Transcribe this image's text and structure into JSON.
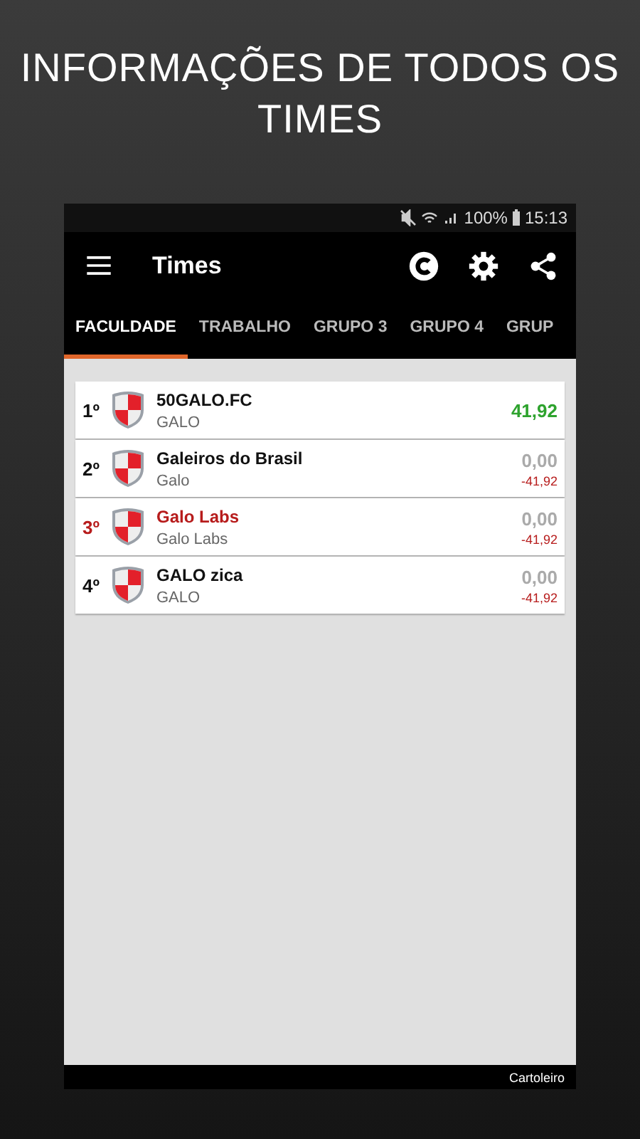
{
  "headline": "INFORMAÇÕES DE TODOS OS TIMES",
  "status_bar": {
    "battery": "100%",
    "time": "15:13"
  },
  "toolbar": {
    "title": "Times"
  },
  "tabs": [
    {
      "label": "FACULDADE",
      "selected": true
    },
    {
      "label": "TRABALHO",
      "selected": false
    },
    {
      "label": "GRUPO 3",
      "selected": false
    },
    {
      "label": "GRUPO 4",
      "selected": false
    },
    {
      "label": "GRUP",
      "selected": false
    }
  ],
  "teams": [
    {
      "position": "1º",
      "name": "50GALO.FC",
      "owner": "GALO",
      "score": "41,92",
      "leading": true,
      "highlighted": false
    },
    {
      "position": "2º",
      "name": "Galeiros do Brasil",
      "owner": "Galo",
      "score": "0,00",
      "diff": "-41,92",
      "leading": false,
      "highlighted": false
    },
    {
      "position": "3º",
      "name": "Galo Labs",
      "owner": "Galo Labs",
      "score": "0,00",
      "diff": "-41,92",
      "leading": false,
      "highlighted": true
    },
    {
      "position": "4º",
      "name": "GALO zica",
      "owner": "GALO",
      "score": "0,00",
      "diff": "-41,92",
      "leading": false,
      "highlighted": false
    }
  ],
  "footer": {
    "label": "Cartoleiro"
  }
}
